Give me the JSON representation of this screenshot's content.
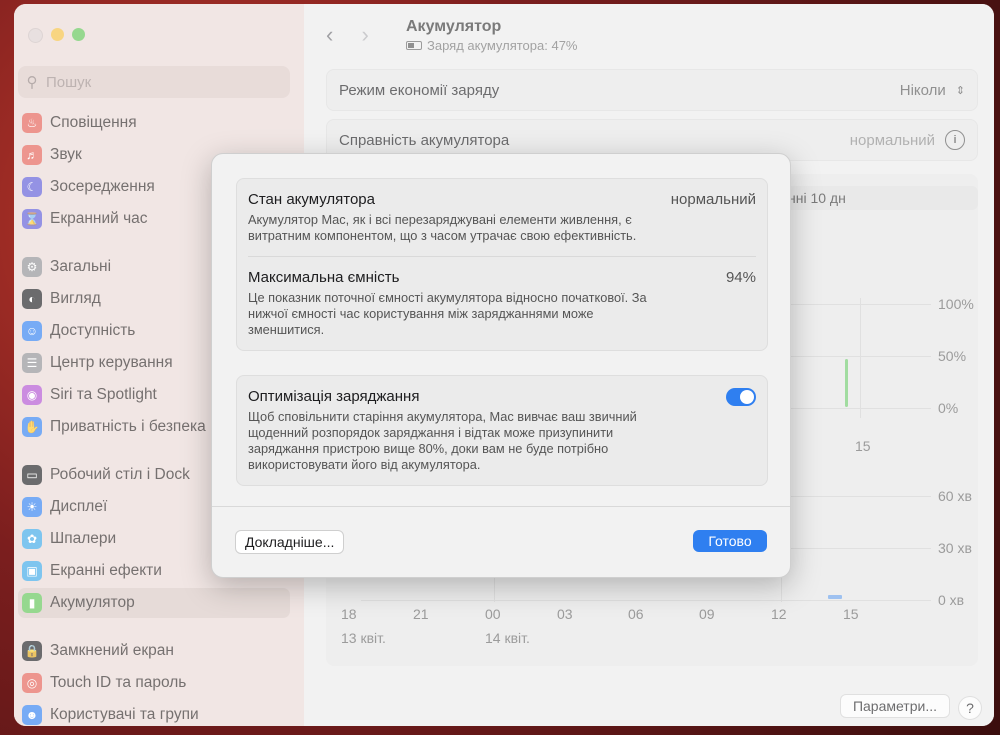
{
  "window": {
    "title": "Акумулятор",
    "subtitle": "Заряд акумулятора: 47%"
  },
  "sidebar": {
    "search_placeholder": "Пошук",
    "items": [
      {
        "label": "Сповіщення",
        "icon": "bell-icon",
        "color": "#e45d52"
      },
      {
        "label": "Звук",
        "icon": "speaker-icon",
        "color": "#e45d52"
      },
      {
        "label": "Зосередження",
        "icon": "moon-icon",
        "color": "#5b58d6"
      },
      {
        "label": "Екранний час",
        "icon": "hourglass-icon",
        "color": "#5b58d6"
      },
      {
        "label": "Загальні",
        "icon": "gear-icon",
        "color": "#8e8e93"
      },
      {
        "label": "Вигляд",
        "icon": "appearance-icon",
        "color": "#1d1d1f"
      },
      {
        "label": "Доступність",
        "icon": "accessibility-icon",
        "color": "#2f7ff0"
      },
      {
        "label": "Центр керування",
        "icon": "control-center-icon",
        "color": "#8e8e93"
      },
      {
        "label": "Siri та Spotlight",
        "icon": "siri-icon",
        "color": "#b04fd0"
      },
      {
        "label": "Приватність і безпека",
        "icon": "hand-icon",
        "color": "#2f7ff0"
      },
      {
        "label": "Робочий стіл і Dock",
        "icon": "dock-icon",
        "color": "#1d1d1f"
      },
      {
        "label": "Дисплеї",
        "icon": "sun-icon",
        "color": "#2f7ff0"
      },
      {
        "label": "Шпалери",
        "icon": "flower-icon",
        "color": "#3aa6e6"
      },
      {
        "label": "Екранні ефекти",
        "icon": "screensaver-icon",
        "color": "#3aa6e6"
      },
      {
        "label": "Акумулятор",
        "icon": "battery-icon",
        "color": "#5fc454"
      },
      {
        "label": "Замкнений екран",
        "icon": "lock-icon",
        "color": "#1d1d1f"
      },
      {
        "label": "Touch ID та пароль",
        "icon": "fingerprint-icon",
        "color": "#e45d52"
      },
      {
        "label": "Користувачі та групи",
        "icon": "users-icon",
        "color": "#2f7ff0"
      }
    ]
  },
  "main": {
    "low_power": {
      "label": "Режим економії заряду",
      "value": "Ніколи"
    },
    "health": {
      "label": "Справність акумулятора",
      "value": "нормальний"
    },
    "segment_label": "нні 10 дн",
    "level_ticks": [
      "100%",
      "50%",
      "0%"
    ],
    "usage_ticks": [
      "60 хв",
      "30 хв",
      "0 хв"
    ],
    "x_ticks": [
      "18",
      "21",
      "00",
      "03",
      "06",
      "09",
      "12",
      "15"
    ],
    "date_labels": [
      "13 квіт.",
      "14 квіт."
    ],
    "upper_tick": "15",
    "options_button": "Параметри...",
    "help_button": "?"
  },
  "modal": {
    "condition": {
      "title": "Стан акумулятора",
      "value": "нормальний",
      "desc": "Акумулятор Mac, як і всі перезаряджувані елементи живлення, є витратним компонентом, що з часом утрачає свою ефективність."
    },
    "capacity": {
      "title": "Максимальна ємність",
      "value": "94%",
      "desc": "Це показник поточної ємності акумулятора відносно початкової. За нижчої ємності час користування між заряджаннями може зменшитися."
    },
    "optimize": {
      "title": "Оптимізація заряджання",
      "enabled": true,
      "desc": "Щоб сповільнити старіння акумулятора, Mac вивчає ваш звичний щоденний розпорядок заряджання і відтак може призупинити заряджання пристрою вище 80%, доки вам не буде потрібно використовувати його від акумулятора."
    },
    "details_button": "Докладніше...",
    "done_button": "Готово"
  }
}
